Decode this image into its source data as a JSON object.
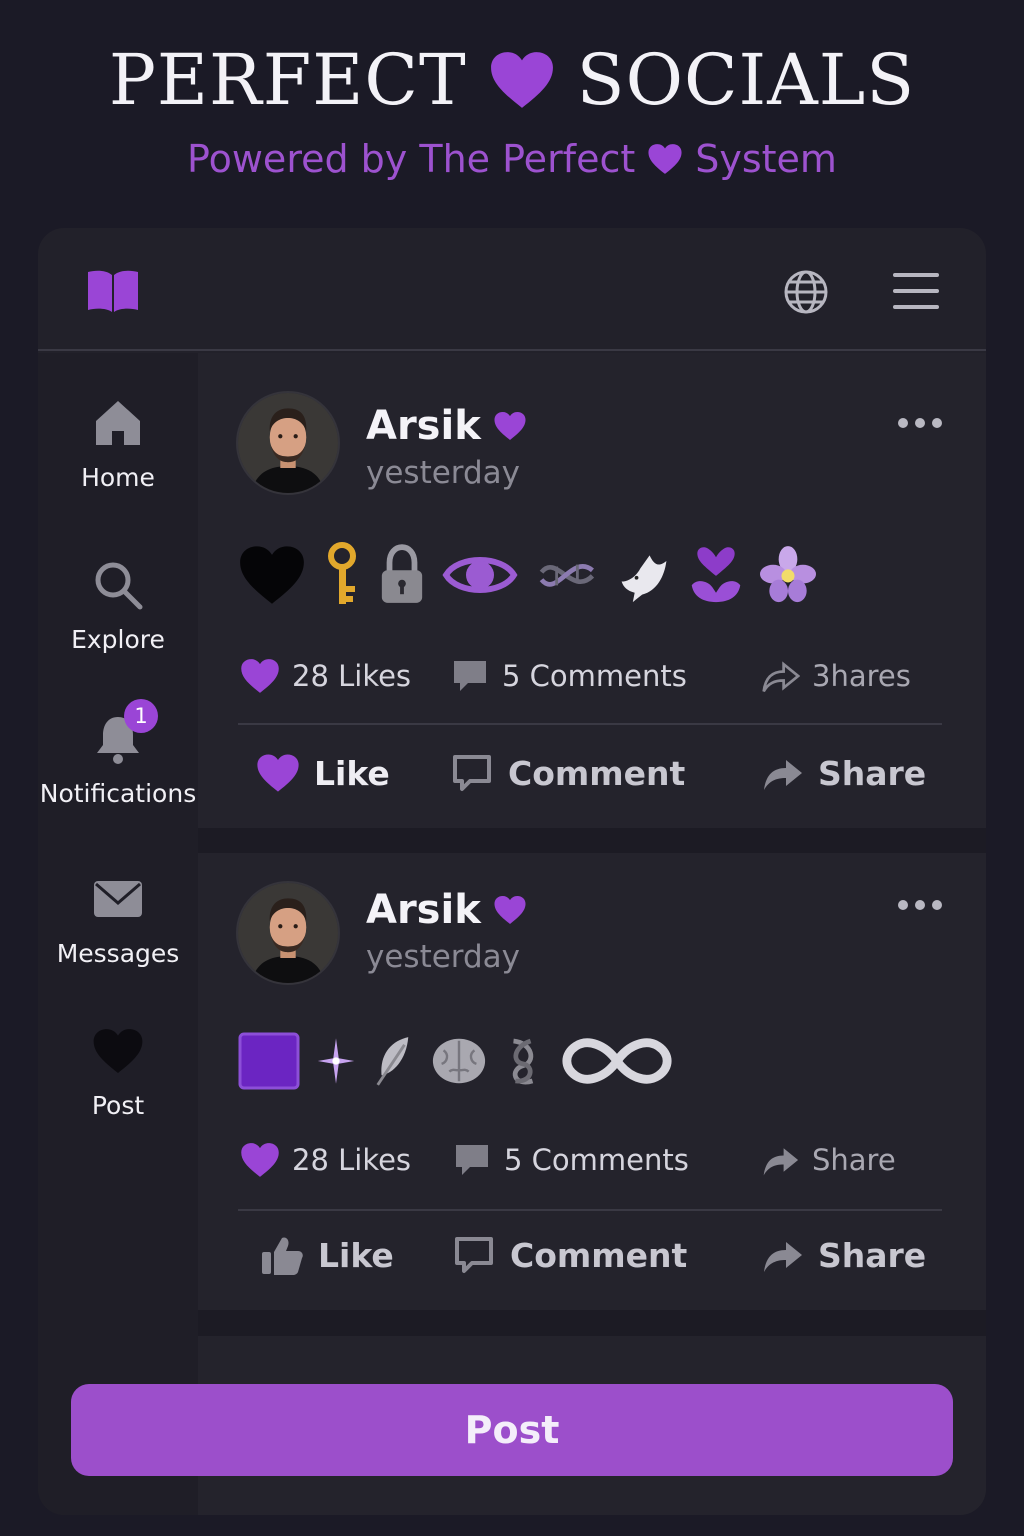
{
  "header": {
    "title_left": "PERFECT",
    "title_right": "SOCIALS",
    "subtitle_left": "Powered by The Perfect",
    "subtitle_right": "System"
  },
  "colors": {
    "accent": "#9c4fcb",
    "heart": "#9a45d6",
    "background": "#1b1a26",
    "panel": "#22212a"
  },
  "topbar": {
    "left_icon": "book-icon",
    "right_icons": [
      "globe-icon",
      "hamburger-menu-icon"
    ]
  },
  "sidebar": {
    "items": [
      {
        "label": "Home",
        "icon": "home-icon"
      },
      {
        "label": "Explore",
        "icon": "search-icon"
      },
      {
        "label": "Notifications",
        "icon": "bell-icon",
        "badge": "1"
      },
      {
        "label": "Messages",
        "icon": "envelope-icon"
      },
      {
        "label": "Post",
        "icon": "black-heart-icon"
      }
    ]
  },
  "posts": [
    {
      "author": "Arsik",
      "time": "yesterday",
      "emojis": [
        "black-heart",
        "key",
        "padlock",
        "eye",
        "dna",
        "dove",
        "heart-hands",
        "flower"
      ],
      "stats": {
        "likes": "28 Likes",
        "comments": "5 Comments",
        "shares": "3hares"
      },
      "actions": {
        "like": "Like",
        "comment": "Comment",
        "share": "Share"
      }
    },
    {
      "author": "Arsik",
      "time": "yesterday",
      "emojis": [
        "purple-square",
        "sparkle",
        "feather",
        "brain",
        "knot",
        "infinity"
      ],
      "stats": {
        "likes": "28 Likes",
        "comments": "5 Comments",
        "shares": "Share"
      },
      "actions": {
        "like": "Like",
        "comment": "Comment",
        "share": "Share"
      }
    }
  ],
  "post_button": "Post"
}
